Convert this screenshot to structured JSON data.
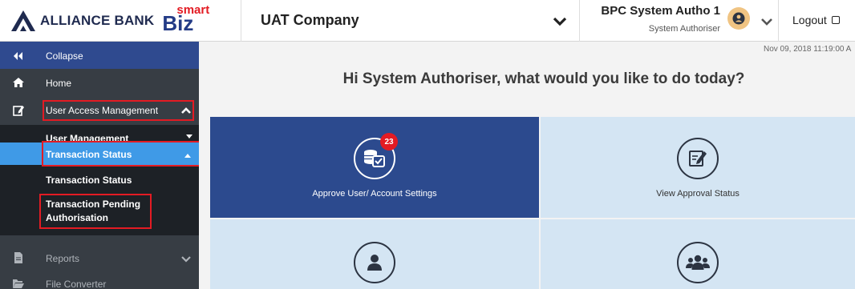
{
  "header": {
    "logo_text": "ALLIANCE BANK",
    "biz_text": "Biz",
    "smart_text": "smart",
    "company": "UAT Company",
    "user_name": "BPC System Autho 1",
    "user_role": "System Authoriser",
    "logout_label": "Logout"
  },
  "sidebar": {
    "collapse_label": "Collapse",
    "home_label": "Home",
    "uam_label": "User Access Management",
    "user_management_label": "User Management",
    "transaction_status_label": "Transaction Status",
    "transaction_status_sub_label": "Transaction Status",
    "pending_line1": "Transaction Pending",
    "pending_line2": "Authorisation",
    "reports_label": "Reports",
    "file_converter_label": "File Converter"
  },
  "main": {
    "datetime": "Nov 09, 2018 11:19:00 A",
    "greeting": "Hi System Authoriser, what would you like to do today?",
    "tiles": [
      {
        "label": "Approve User/ Account Settings",
        "badge": "23"
      },
      {
        "label": "View Approval Status"
      }
    ]
  },
  "colors": {
    "brand_navy": "#2c4a8e",
    "highlight_red": "#e31b23",
    "active_blue": "#3f9ae7",
    "sidebar_dark": "#373d44"
  }
}
